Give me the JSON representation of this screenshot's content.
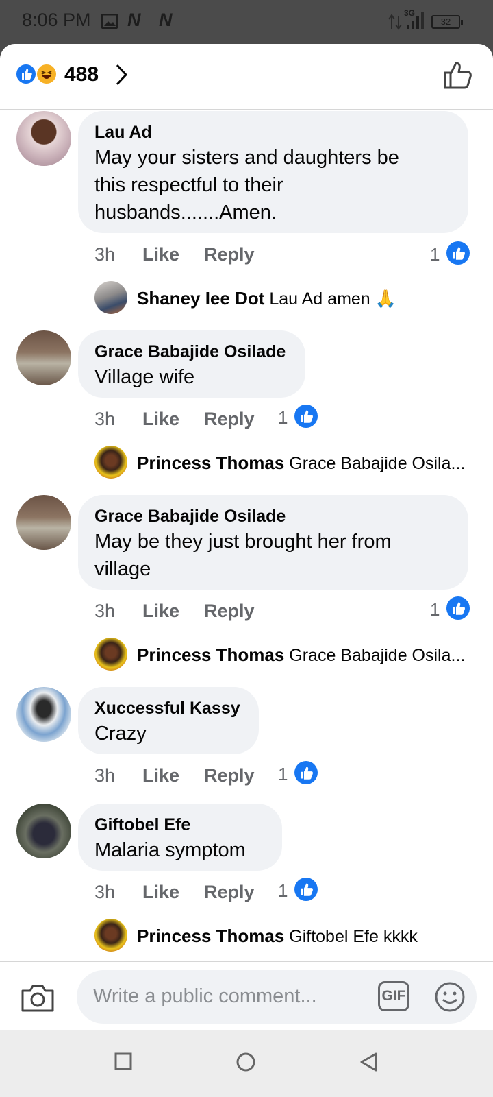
{
  "status": {
    "time": "8:06 PM",
    "network": "3G",
    "battery": "32"
  },
  "header": {
    "reaction_count": "488"
  },
  "comments": [
    {
      "name": "Lau Ad",
      "text": "May your sisters and daughters be this respectful to their husbands.......Amen.",
      "line1": "May your sisters and daughters be",
      "line2": "this respectful to their",
      "line3": "husbands.......Amen.",
      "time": "3h",
      "like": "Like",
      "reply": "Reply",
      "likes": "1"
    },
    {
      "name": "Grace Babajide Osilade",
      "text": "Village wife",
      "time": "3h",
      "like": "Like",
      "reply": "Reply",
      "likes": "1"
    },
    {
      "name": "Grace Babajide Osilade",
      "line1": "May be they just brought her from",
      "line2": "village",
      "time": "3h",
      "like": "Like",
      "reply": "Reply",
      "likes": "1"
    },
    {
      "name": "Xuccessful Kassy",
      "text": "Crazy",
      "time": "3h",
      "like": "Like",
      "reply": "Reply",
      "likes": "1"
    },
    {
      "name": "Giftobel Efe",
      "text": "Malaria symptom",
      "time": "3h",
      "like": "Like",
      "reply": "Reply",
      "likes": "1"
    }
  ],
  "replies": [
    {
      "name": "Shaney Iee Dot",
      "text": "Lau Ad amen 🙏"
    },
    {
      "name": "Princess Thomas",
      "text": "Grace Babajide Osila..."
    },
    {
      "name": "Princess Thomas",
      "text": "Grace Babajide Osila..."
    },
    {
      "name": "Princess Thomas",
      "text": "Giftobel Efe kkkk"
    }
  ],
  "composer": {
    "placeholder": "Write a public comment...",
    "gif": "GIF"
  },
  "colors": {
    "accent": "#1877f2",
    "bubble": "#f0f2f5",
    "muted": "#65676b"
  }
}
